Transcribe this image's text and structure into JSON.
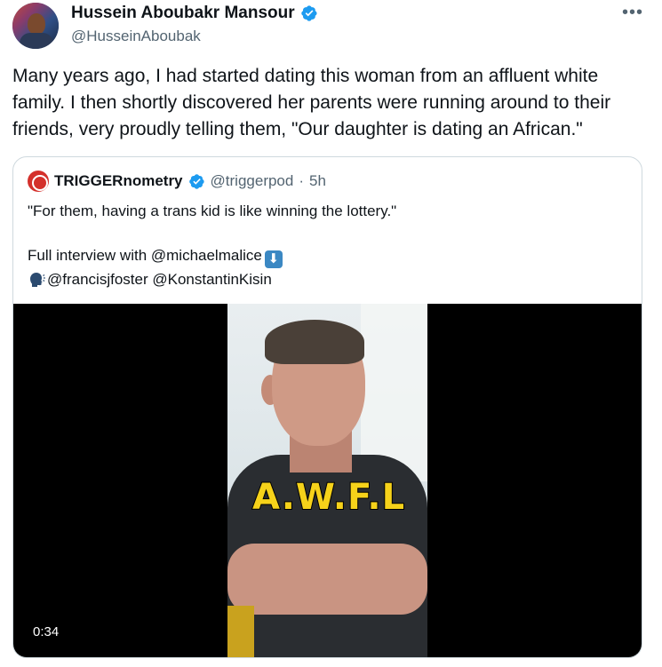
{
  "author": {
    "name": "Hussein Aboubakr Mansour",
    "handle": "@HusseinAboubak"
  },
  "tweet": {
    "text": "Many years ago, I had started dating this woman from an affluent white family. I then shortly discovered her parents were running around to their friends, very proudly telling them, \"Our daughter is dating an African.\""
  },
  "more_icon": "more-horizontal-icon",
  "quote": {
    "name": "TRIGGERnometry",
    "handle": "@triggerpod",
    "separator": "·",
    "time": "5h",
    "lines": [
      "\"For them, having a trans kid is like winning the lottery.\"",
      "",
      "Full interview with @michaelmalice",
      "@francisjfoster @KonstantinKisin"
    ],
    "video": {
      "caption": "A.W.F.L",
      "duration": "0:34"
    }
  },
  "colors": {
    "verified": "#1d9bf0",
    "text": "#0f1419",
    "muted": "#536471",
    "border": "#cfd9de",
    "caption": "#f6d21a"
  }
}
